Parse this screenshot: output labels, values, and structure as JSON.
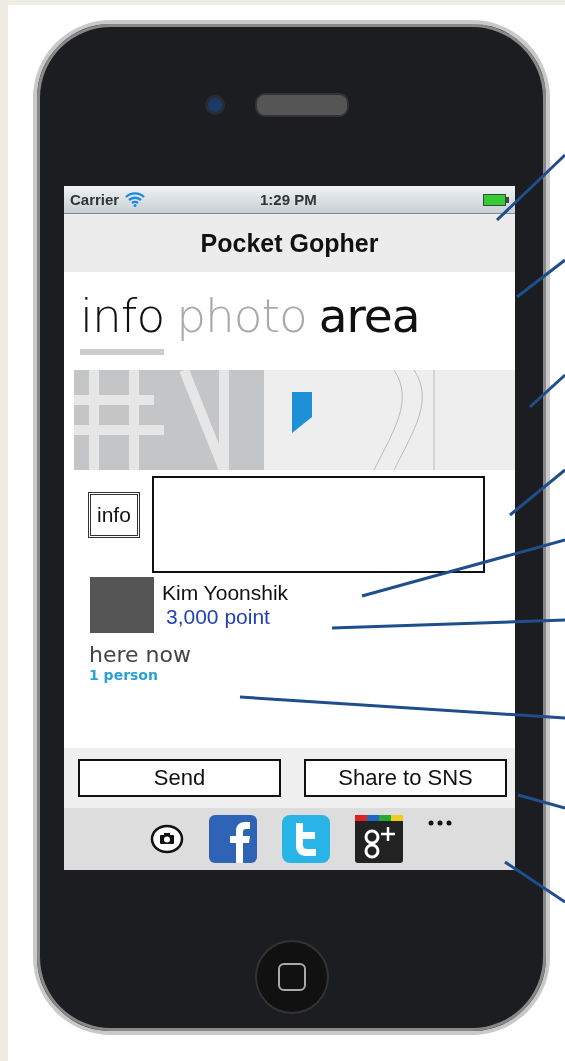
{
  "status_bar": {
    "carrier": "Carrier",
    "time": "1:29 PM"
  },
  "nav_bar": {
    "title": "Pocket Gopher"
  },
  "tabs": [
    {
      "label": "info",
      "selected": true,
      "dimmed": false
    },
    {
      "label": "photo",
      "selected": false,
      "dimmed": true
    },
    {
      "label": "area",
      "selected": false,
      "dimmed": false
    }
  ],
  "info": {
    "label": "info"
  },
  "user": {
    "name": "Kim Yoonshik",
    "points": "3,000 point"
  },
  "here_now": {
    "title": "here now",
    "count": "1 person"
  },
  "buttons": [
    "Send",
    "Share to SNS"
  ],
  "toolbar": [
    {
      "kind": "camera"
    },
    {
      "kind": "facebook"
    },
    {
      "kind": "twitter"
    },
    {
      "kind": "googleplus"
    },
    {
      "kind": "more"
    }
  ]
}
